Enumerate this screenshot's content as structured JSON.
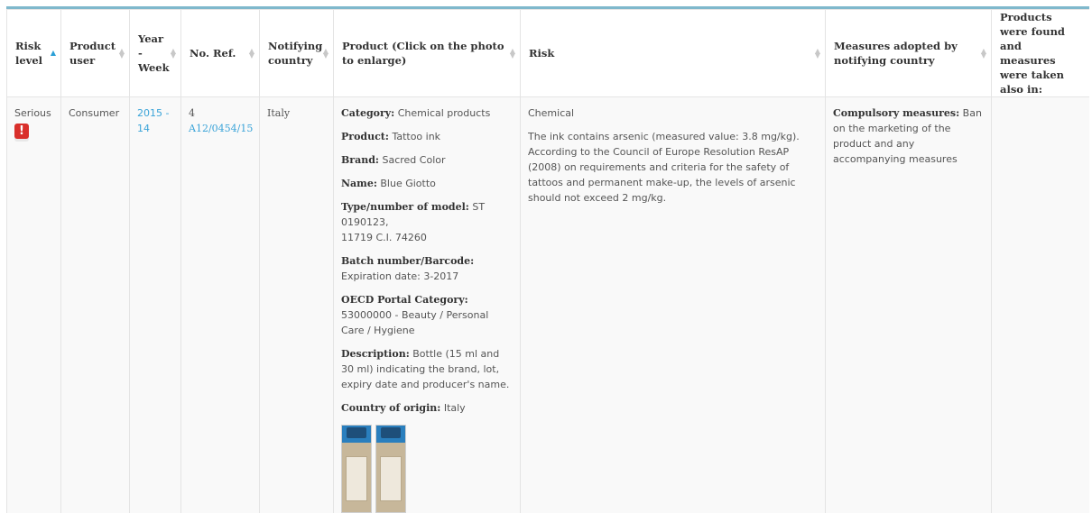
{
  "table": {
    "headers": [
      {
        "label": "Risk level",
        "sort": "asc"
      },
      {
        "label": "Product user",
        "sort": "none"
      },
      {
        "label": "Year - Week",
        "sort": "none"
      },
      {
        "label": "No. Ref.",
        "sort": "none"
      },
      {
        "label": "Notifying country",
        "sort": "none"
      },
      {
        "label": "Product (Click on the photo to enlarge)",
        "sort": "none"
      },
      {
        "label": "Risk",
        "sort": "none"
      },
      {
        "label": "Measures adopted by notifying country",
        "sort": "none"
      },
      {
        "label": "Products were found and measures were taken also in:",
        "sort": "none"
      }
    ],
    "row": {
      "risk_level": "Serious",
      "risk_icon": "warning-icon",
      "risk_icon_glyph": "!",
      "product_user": "Consumer",
      "year_week": "2015 - 14",
      "ref_number": "4",
      "ref_code": "A12/0454/15",
      "notifying_country": "Italy",
      "product": {
        "category_label": "Category:",
        "category": "Chemical products",
        "product_label": "Product:",
        "product": "Tattoo ink",
        "brand_label": "Brand:",
        "brand": "Sacred Color",
        "name_label": "Name:",
        "name": "Blue Giotto",
        "model_label": "Type/number of model:",
        "model": "ST 0190123,",
        "model_line2": "11719 C.I. 74260",
        "batch_label": "Batch number/Barcode:",
        "batch": "Expiration date: 3-2017",
        "oecd_label": "OECD Portal Category:",
        "oecd": "53000000 - Beauty / Personal Care / Hygiene",
        "description_label": "Description:",
        "description": "Bottle (15 ml and 30 ml) indicating the brand, lot, expiry date and producer's name.",
        "origin_label": "Country of origin:",
        "origin": "Italy"
      },
      "risk": {
        "type": "Chemical",
        "text": "The ink contains arsenic (measured value: 3.8 mg/kg). According to the Council of Europe Resolution ResAP (2008) on requirements and criteria for the safety of tattoos and permanent make-up, the levels of arsenic should not exceed 2 mg/kg."
      },
      "measures": {
        "label": "Compulsory measures:",
        "text": "Ban on the marketing of the product and any accompanying measures"
      },
      "also_in": ""
    }
  },
  "colors": {
    "link": "#39a3d8",
    "accent_line": "#7fb8cc",
    "warning": "#d9302b"
  }
}
